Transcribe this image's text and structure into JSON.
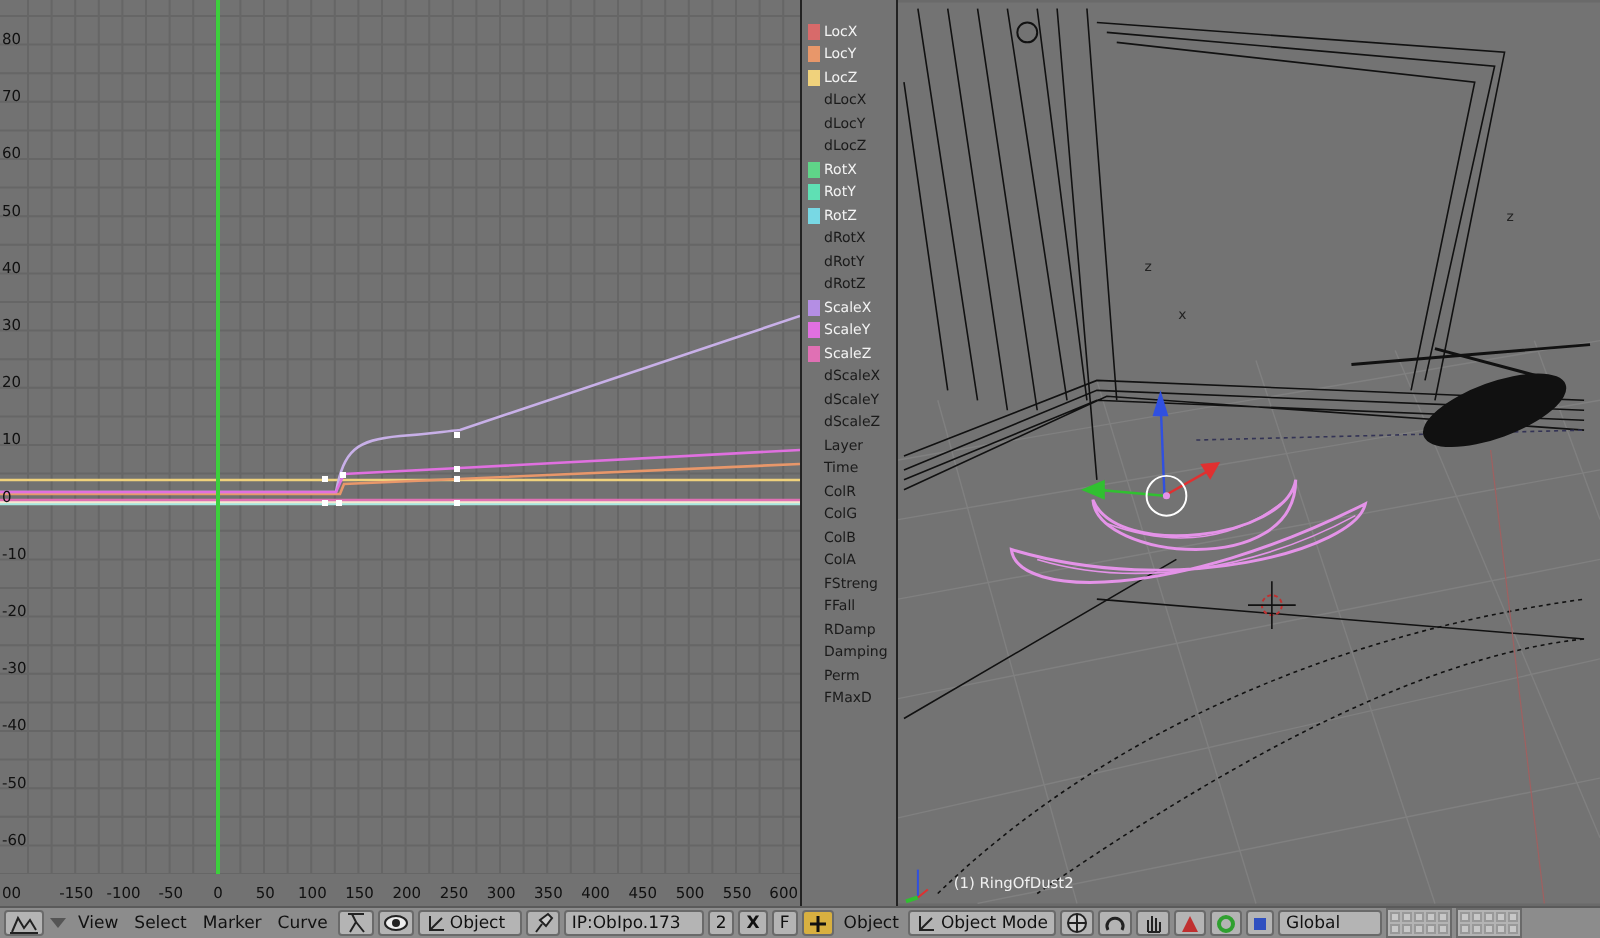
{
  "ipo_editor": {
    "y_ticks": [
      "80",
      "70",
      "60",
      "50",
      "40",
      "30",
      "20",
      "10",
      "0",
      "-10",
      "-20",
      "-30",
      "-40",
      "-50",
      "-60"
    ],
    "x_ticks": [
      "00",
      "-150",
      "-100",
      "-50",
      "0",
      "50",
      "100",
      "150",
      "200",
      "250",
      "300",
      "350",
      "400",
      "450",
      "500",
      "550",
      "600"
    ]
  },
  "channels": [
    {
      "name": "LocX",
      "color": "#d86a6a"
    },
    {
      "name": "LocY",
      "color": "#e8976a"
    },
    {
      "name": "LocZ",
      "color": "#f0d27c"
    },
    {
      "name": "dLocX"
    },
    {
      "name": "dLocY"
    },
    {
      "name": "dLocZ"
    },
    {
      "name": "RotX",
      "color": "#5fd488"
    },
    {
      "name": "RotY",
      "color": "#5fe0b4"
    },
    {
      "name": "RotZ",
      "color": "#78d8e4"
    },
    {
      "name": "dRotX"
    },
    {
      "name": "dRotY"
    },
    {
      "name": "dRotZ"
    },
    {
      "name": "ScaleX",
      "color": "#b48ee4"
    },
    {
      "name": "ScaleY",
      "color": "#e070e0"
    },
    {
      "name": "ScaleZ",
      "color": "#e070b4"
    },
    {
      "name": "dScaleX"
    },
    {
      "name": "dScaleY"
    },
    {
      "name": "dScaleZ"
    },
    {
      "name": "Layer"
    },
    {
      "name": "Time"
    },
    {
      "name": "ColR"
    },
    {
      "name": "ColG"
    },
    {
      "name": "ColB"
    },
    {
      "name": "ColA"
    },
    {
      "name": "FStreng"
    },
    {
      "name": "FFall"
    },
    {
      "name": "RDamp"
    },
    {
      "name": "Damping"
    },
    {
      "name": "Perm"
    },
    {
      "name": "FMaxD"
    }
  ],
  "viewport": {
    "object_label": "(1) RingOfDust2",
    "axis_labels": [
      "z",
      "x",
      "z"
    ]
  },
  "ipo_header": {
    "menus": [
      "View",
      "Select",
      "Marker",
      "Curve"
    ],
    "object_dropdown": "Object",
    "ipo_block": "IP:ObIpo.173",
    "users": "2",
    "x_button": "X",
    "f_button": "F"
  },
  "view3d_header": {
    "menus": [
      "Object"
    ],
    "mode_dropdown": "Object Mode",
    "orientation_dropdown": "Global"
  }
}
